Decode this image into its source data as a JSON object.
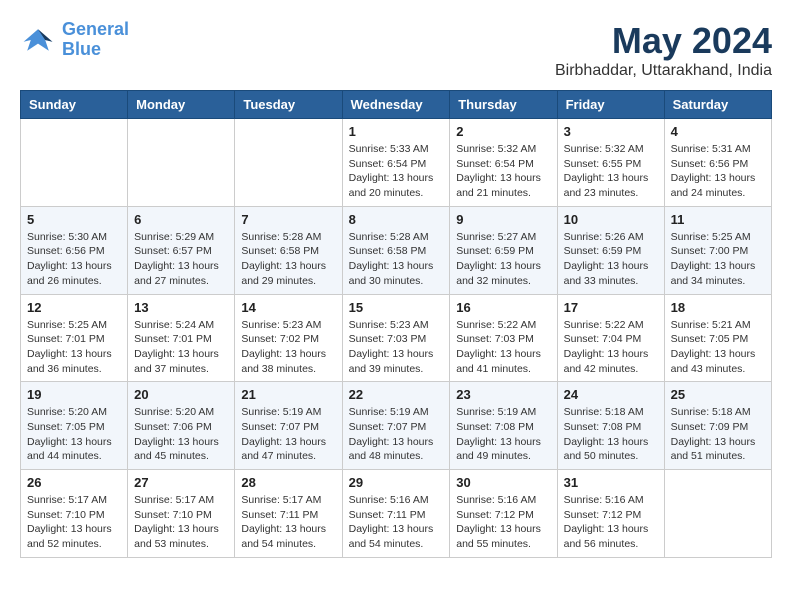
{
  "header": {
    "logo_line1": "General",
    "logo_line2": "Blue",
    "month": "May 2024",
    "location": "Birbhaddar, Uttarakhand, India"
  },
  "weekdays": [
    "Sunday",
    "Monday",
    "Tuesday",
    "Wednesday",
    "Thursday",
    "Friday",
    "Saturday"
  ],
  "weeks": [
    [
      {
        "day": "",
        "info": ""
      },
      {
        "day": "",
        "info": ""
      },
      {
        "day": "",
        "info": ""
      },
      {
        "day": "1",
        "info": "Sunrise: 5:33 AM\nSunset: 6:54 PM\nDaylight: 13 hours\nand 20 minutes."
      },
      {
        "day": "2",
        "info": "Sunrise: 5:32 AM\nSunset: 6:54 PM\nDaylight: 13 hours\nand 21 minutes."
      },
      {
        "day": "3",
        "info": "Sunrise: 5:32 AM\nSunset: 6:55 PM\nDaylight: 13 hours\nand 23 minutes."
      },
      {
        "day": "4",
        "info": "Sunrise: 5:31 AM\nSunset: 6:56 PM\nDaylight: 13 hours\nand 24 minutes."
      }
    ],
    [
      {
        "day": "5",
        "info": "Sunrise: 5:30 AM\nSunset: 6:56 PM\nDaylight: 13 hours\nand 26 minutes."
      },
      {
        "day": "6",
        "info": "Sunrise: 5:29 AM\nSunset: 6:57 PM\nDaylight: 13 hours\nand 27 minutes."
      },
      {
        "day": "7",
        "info": "Sunrise: 5:28 AM\nSunset: 6:58 PM\nDaylight: 13 hours\nand 29 minutes."
      },
      {
        "day": "8",
        "info": "Sunrise: 5:28 AM\nSunset: 6:58 PM\nDaylight: 13 hours\nand 30 minutes."
      },
      {
        "day": "9",
        "info": "Sunrise: 5:27 AM\nSunset: 6:59 PM\nDaylight: 13 hours\nand 32 minutes."
      },
      {
        "day": "10",
        "info": "Sunrise: 5:26 AM\nSunset: 6:59 PM\nDaylight: 13 hours\nand 33 minutes."
      },
      {
        "day": "11",
        "info": "Sunrise: 5:25 AM\nSunset: 7:00 PM\nDaylight: 13 hours\nand 34 minutes."
      }
    ],
    [
      {
        "day": "12",
        "info": "Sunrise: 5:25 AM\nSunset: 7:01 PM\nDaylight: 13 hours\nand 36 minutes."
      },
      {
        "day": "13",
        "info": "Sunrise: 5:24 AM\nSunset: 7:01 PM\nDaylight: 13 hours\nand 37 minutes."
      },
      {
        "day": "14",
        "info": "Sunrise: 5:23 AM\nSunset: 7:02 PM\nDaylight: 13 hours\nand 38 minutes."
      },
      {
        "day": "15",
        "info": "Sunrise: 5:23 AM\nSunset: 7:03 PM\nDaylight: 13 hours\nand 39 minutes."
      },
      {
        "day": "16",
        "info": "Sunrise: 5:22 AM\nSunset: 7:03 PM\nDaylight: 13 hours\nand 41 minutes."
      },
      {
        "day": "17",
        "info": "Sunrise: 5:22 AM\nSunset: 7:04 PM\nDaylight: 13 hours\nand 42 minutes."
      },
      {
        "day": "18",
        "info": "Sunrise: 5:21 AM\nSunset: 7:05 PM\nDaylight: 13 hours\nand 43 minutes."
      }
    ],
    [
      {
        "day": "19",
        "info": "Sunrise: 5:20 AM\nSunset: 7:05 PM\nDaylight: 13 hours\nand 44 minutes."
      },
      {
        "day": "20",
        "info": "Sunrise: 5:20 AM\nSunset: 7:06 PM\nDaylight: 13 hours\nand 45 minutes."
      },
      {
        "day": "21",
        "info": "Sunrise: 5:19 AM\nSunset: 7:07 PM\nDaylight: 13 hours\nand 47 minutes."
      },
      {
        "day": "22",
        "info": "Sunrise: 5:19 AM\nSunset: 7:07 PM\nDaylight: 13 hours\nand 48 minutes."
      },
      {
        "day": "23",
        "info": "Sunrise: 5:19 AM\nSunset: 7:08 PM\nDaylight: 13 hours\nand 49 minutes."
      },
      {
        "day": "24",
        "info": "Sunrise: 5:18 AM\nSunset: 7:08 PM\nDaylight: 13 hours\nand 50 minutes."
      },
      {
        "day": "25",
        "info": "Sunrise: 5:18 AM\nSunset: 7:09 PM\nDaylight: 13 hours\nand 51 minutes."
      }
    ],
    [
      {
        "day": "26",
        "info": "Sunrise: 5:17 AM\nSunset: 7:10 PM\nDaylight: 13 hours\nand 52 minutes."
      },
      {
        "day": "27",
        "info": "Sunrise: 5:17 AM\nSunset: 7:10 PM\nDaylight: 13 hours\nand 53 minutes."
      },
      {
        "day": "28",
        "info": "Sunrise: 5:17 AM\nSunset: 7:11 PM\nDaylight: 13 hours\nand 54 minutes."
      },
      {
        "day": "29",
        "info": "Sunrise: 5:16 AM\nSunset: 7:11 PM\nDaylight: 13 hours\nand 54 minutes."
      },
      {
        "day": "30",
        "info": "Sunrise: 5:16 AM\nSunset: 7:12 PM\nDaylight: 13 hours\nand 55 minutes."
      },
      {
        "day": "31",
        "info": "Sunrise: 5:16 AM\nSunset: 7:12 PM\nDaylight: 13 hours\nand 56 minutes."
      },
      {
        "day": "",
        "info": ""
      }
    ]
  ]
}
